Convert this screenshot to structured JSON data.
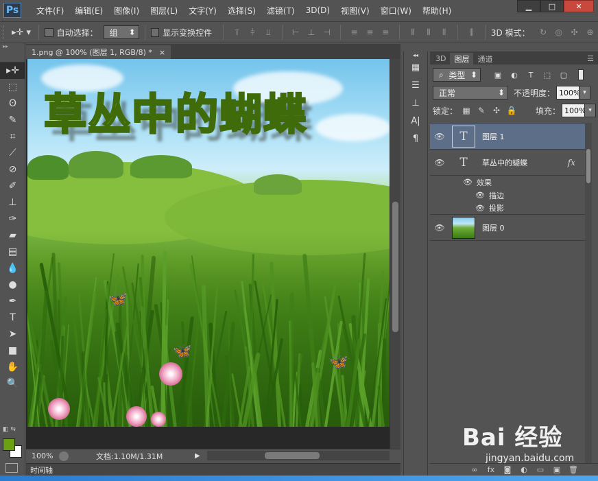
{
  "app": {
    "logo": "Ps"
  },
  "menu": [
    "文件(F)",
    "编辑(E)",
    "图像(I)",
    "图层(L)",
    "文字(Y)",
    "选择(S)",
    "滤镜(T)",
    "3D(D)",
    "视图(V)",
    "窗口(W)",
    "帮助(H)"
  ],
  "window_controls": {
    "minimize": "▁",
    "maximize": "□",
    "close": "✕"
  },
  "options": {
    "tool_icon": "move-tool-icon",
    "auto_select_label": "自动选择：",
    "auto_select_value": "组",
    "show_transform_label": "显示变换控件",
    "mode_3d_label": "3D 模式："
  },
  "document": {
    "tab_title": "1.png @ 100% (图层 1, RGB/8) *",
    "tab_close": "×",
    "title_text": "草丛中的蝴蝶"
  },
  "status": {
    "zoom": "100%",
    "doc_info": "文档:1.10M/1.31M"
  },
  "timeline": {
    "label": "时间轴"
  },
  "layers_panel": {
    "tabs": [
      "3D",
      "图层",
      "通道"
    ],
    "active_tab": "图层",
    "filter_kind": "类型",
    "blend_mode": "正常",
    "opacity_label": "不透明度：",
    "opacity_value": "100%",
    "lock_label": "锁定：",
    "fill_label": "填充：",
    "fill_value": "100%",
    "layers": [
      {
        "name": "图层 1",
        "type": "text",
        "selected": true
      },
      {
        "name": "草丛中的蝴蝶",
        "type": "text",
        "selected": false,
        "fx": "fx",
        "effects_label": "效果",
        "effects": [
          "描边",
          "投影"
        ]
      },
      {
        "name": "图层 0",
        "type": "image",
        "selected": false
      }
    ]
  },
  "watermark": {
    "main": "Bai 经验",
    "sub": "jingyan.baidu.com"
  },
  "colors": {
    "foreground": "#6aa012",
    "background": "#ffffff",
    "selection": "#5d6f88"
  }
}
